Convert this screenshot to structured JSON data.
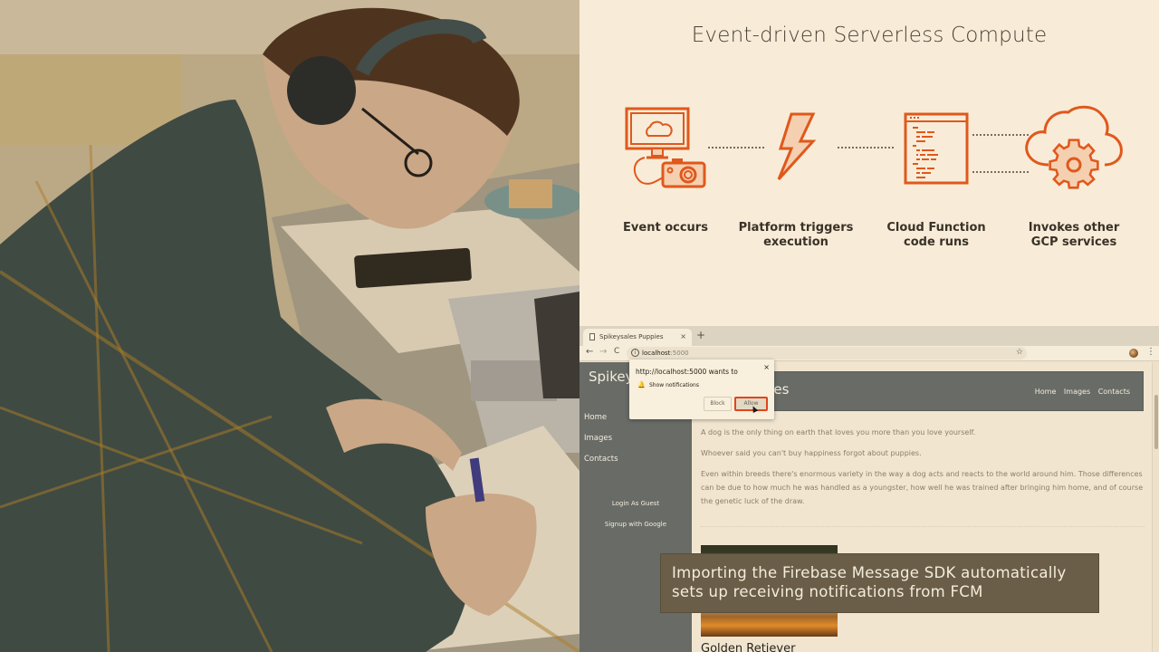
{
  "diagram": {
    "title": "Event-driven Serverless Compute",
    "accent_color": "#e0581c",
    "steps": [
      {
        "label_line1": "Event occurs",
        "label_line2": "",
        "icon": "monitor-camera-icon"
      },
      {
        "label_line1": "Platform triggers",
        "label_line2": "execution",
        "icon": "lightning-bolt-icon"
      },
      {
        "label_line1": "Cloud Function",
        "label_line2": "code runs",
        "icon": "code-window-icon"
      },
      {
        "label_line1": "Invokes other",
        "label_line2": "GCP services",
        "icon": "cloud-gear-icon"
      }
    ]
  },
  "browser": {
    "tab_title": "Spikeysales Puppies",
    "tab_close": "×",
    "new_tab": "+",
    "back": "←",
    "forward": "→",
    "reload": "C",
    "url_host": "localhost",
    "url_port": ":5000",
    "info": "i",
    "star": "☆",
    "menu": "⋮",
    "permission_popup": {
      "title": "http://localhost:5000 wants to",
      "close": "×",
      "item": "Show notifications",
      "block_label": "Block",
      "allow_label": "Allow"
    },
    "site": {
      "sidebar_brand": "SpikeySales",
      "header_brand": "SpikeySales",
      "sidebar_links": [
        "Home",
        "Images",
        "Contacts"
      ],
      "auth_links": [
        "Login As Guest",
        "Signup with Google"
      ],
      "header_nav": [
        "Home",
        "Images",
        "Contacts"
      ],
      "paragraphs": [
        "A dog is the only thing on earth that loves you more than you love yourself.",
        "Whoever said you can't buy happiness forgot about puppies.",
        "Even within breeds there's enormous variety in the way a dog acts and reacts to the world around him. Those differences can be due to how much he was handled as a youngster, how well he was trained after bringing him home, and of course the genetic luck of the draw."
      ],
      "puppy_title": "Golden Retiever"
    }
  },
  "caption": {
    "line1": "Importing the Firebase Message SDK automatically",
    "line2": "sets up receiving notifications from FCM"
  }
}
